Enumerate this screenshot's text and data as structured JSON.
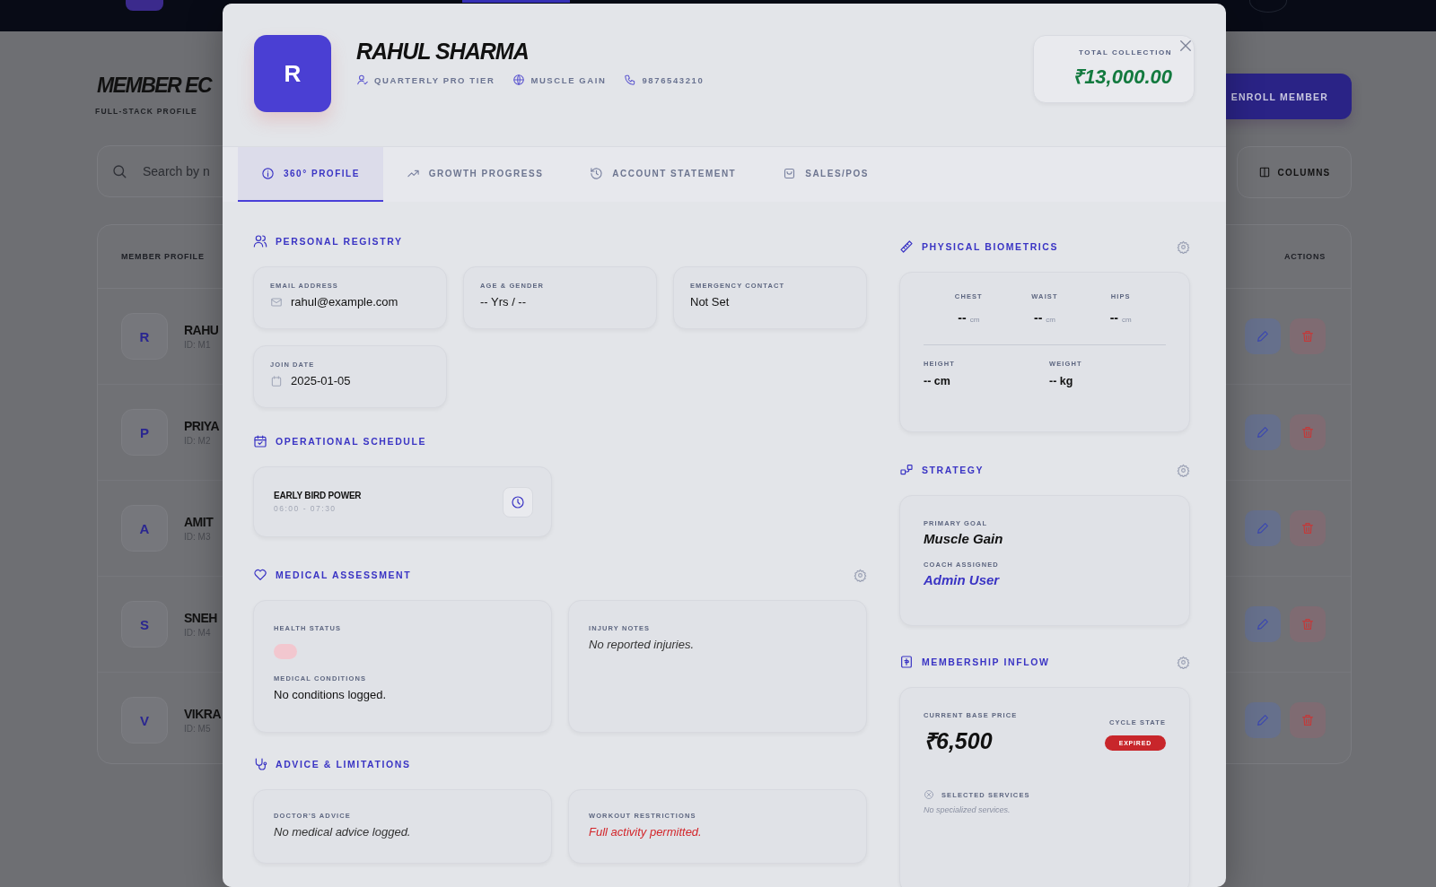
{
  "background": {
    "title": "MEMBER EC",
    "subtitle": "FULL-STACK PROFILE",
    "search": {
      "placeholder": "Search by n"
    },
    "enroll_button": "ENROLL MEMBER",
    "columns_button": "COLUMNS",
    "table": {
      "columns": [
        "MEMBER PROFILE",
        "ACTIONS"
      ],
      "rows": [
        {
          "initial": "R",
          "name": "RAHU",
          "id": "ID: M1"
        },
        {
          "initial": "P",
          "name": "PRIYA",
          "id": "ID: M2"
        },
        {
          "initial": "A",
          "name": "AMIT",
          "id": "ID: M3"
        },
        {
          "initial": "S",
          "name": "SNEH",
          "id": "ID: M4"
        },
        {
          "initial": "V",
          "name": "VIKRA",
          "id": "ID: M5"
        }
      ]
    }
  },
  "modal": {
    "avatar": "R",
    "name": "RAHUL SHARMA",
    "meta": [
      "QUARTERLY PRO TIER",
      "MUSCLE GAIN",
      "9876543210"
    ],
    "total_collection": {
      "label": "TOTAL COLLECTION",
      "value": "₹13,000.00"
    },
    "tabs": [
      {
        "label": "360° PROFILE",
        "selected": true
      },
      {
        "label": "GROWTH PROGRESS",
        "selected": false
      },
      {
        "label": "ACCOUNT STATEMENT",
        "selected": false
      },
      {
        "label": "SALES/POS",
        "selected": false
      }
    ],
    "personal_registry": {
      "title": "PERSONAL REGISTRY",
      "fields": [
        {
          "label": "EMAIL ADDRESS",
          "value": "rahul@example.com",
          "kind": "email"
        },
        {
          "label": "AGE & GENDER",
          "value": "-- Yrs / --",
          "kind": "plain"
        },
        {
          "label": "EMERGENCY CONTACT",
          "value": "Not Set",
          "kind": "plain"
        },
        {
          "label": "JOIN DATE",
          "value": "2025-01-05",
          "kind": "date"
        }
      ]
    },
    "operational_schedule": {
      "title": "OPERATIONAL SCHEDULE",
      "slots": [
        {
          "name": "EARLY BIRD POWER",
          "time": "06:00 - 07:30"
        }
      ]
    },
    "medical_assessment": {
      "title": "MEDICAL ASSESSMENT",
      "health_status_label": "HEALTH STATUS",
      "conditions_label": "MEDICAL CONDITIONS",
      "conditions": "No conditions logged.",
      "injury_label": "INJURY NOTES",
      "injury_notes": "No reported injuries."
    },
    "advice": {
      "title": "ADVICE & LIMITATIONS",
      "doctor_label": "DOCTOR'S ADVICE",
      "doctor_advice": "No medical advice logged.",
      "restrictions_label": "WORKOUT RESTRICTIONS",
      "restrictions": "Full activity permitted."
    },
    "biometrics": {
      "title": "PHYSICAL BIOMETRICS",
      "measures": [
        {
          "label": "CHEST",
          "value": "--",
          "unit": "cm"
        },
        {
          "label": "WAIST",
          "value": "--",
          "unit": "cm"
        },
        {
          "label": "HIPS",
          "value": "--",
          "unit": "cm"
        }
      ],
      "height": {
        "label": "HEIGHT",
        "value": "-- cm"
      },
      "weight": {
        "label": "WEIGHT",
        "value": "-- kg"
      }
    },
    "strategy": {
      "title": "STRATEGY",
      "goal_label": "PRIMARY GOAL",
      "goal": "Muscle Gain",
      "coach_label": "COACH ASSIGNED",
      "coach": "Admin User"
    },
    "membership": {
      "title": "MEMBERSHIP INFLOW",
      "price_label": "CURRENT BASE PRICE",
      "price": "₹6,500",
      "cycle_label": "CYCLE STATE",
      "cycle_state": "EXPIRED",
      "services_label": "SELECTED SERVICES",
      "services": "No specialized services."
    }
  }
}
